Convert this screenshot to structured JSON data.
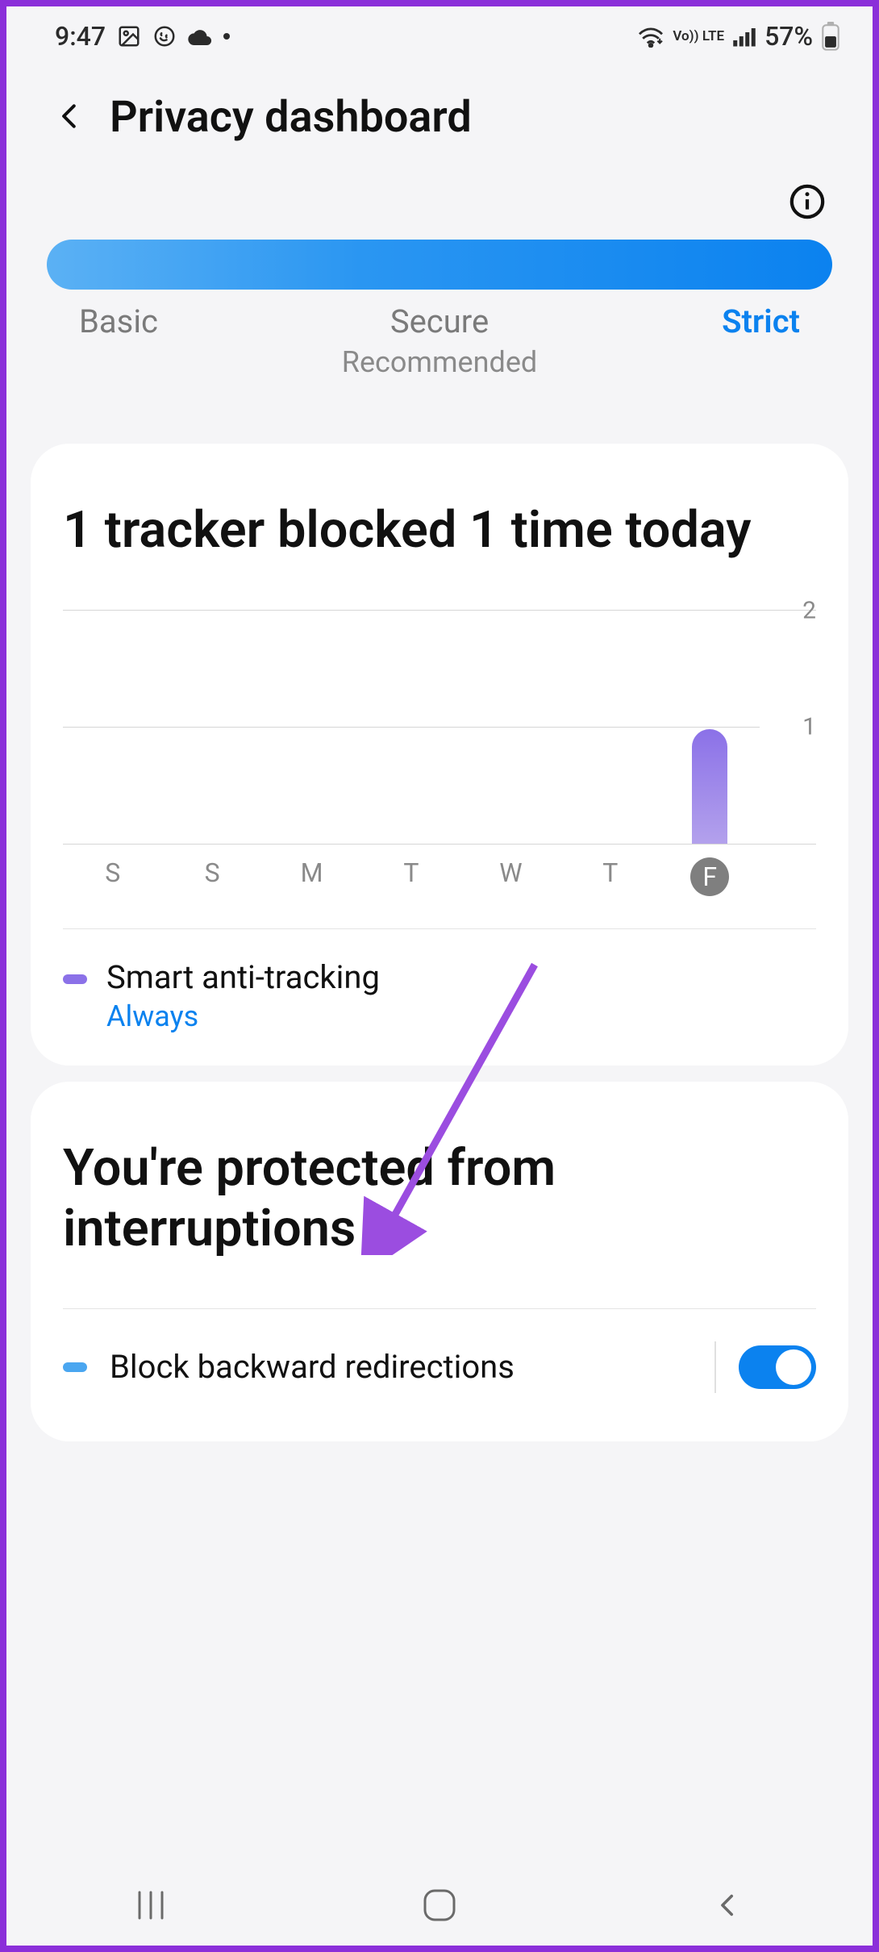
{
  "status": {
    "time": "9:47",
    "battery": "57%",
    "volte": "Vo)) LTE"
  },
  "header": {
    "title": "Privacy dashboard"
  },
  "levels": {
    "basic": "Basic",
    "secure": "Secure",
    "secure_sub": "Recommended",
    "strict": "Strict"
  },
  "tracker_card": {
    "title": "1 tracker blocked 1 time today",
    "legend_title": "Smart anti-tracking",
    "legend_value": "Always"
  },
  "chart_data": {
    "type": "bar",
    "categories": [
      "S",
      "S",
      "M",
      "T",
      "W",
      "T",
      "F"
    ],
    "values": [
      0,
      0,
      0,
      0,
      0,
      0,
      1
    ],
    "active_index": 6,
    "ylim": [
      0,
      2
    ],
    "yticks": [
      1,
      2
    ],
    "ylabel": "",
    "xlabel": ""
  },
  "protect_card": {
    "title": "You're protected from interruptions",
    "option1": "Block backward redirections",
    "option1_on": true
  }
}
